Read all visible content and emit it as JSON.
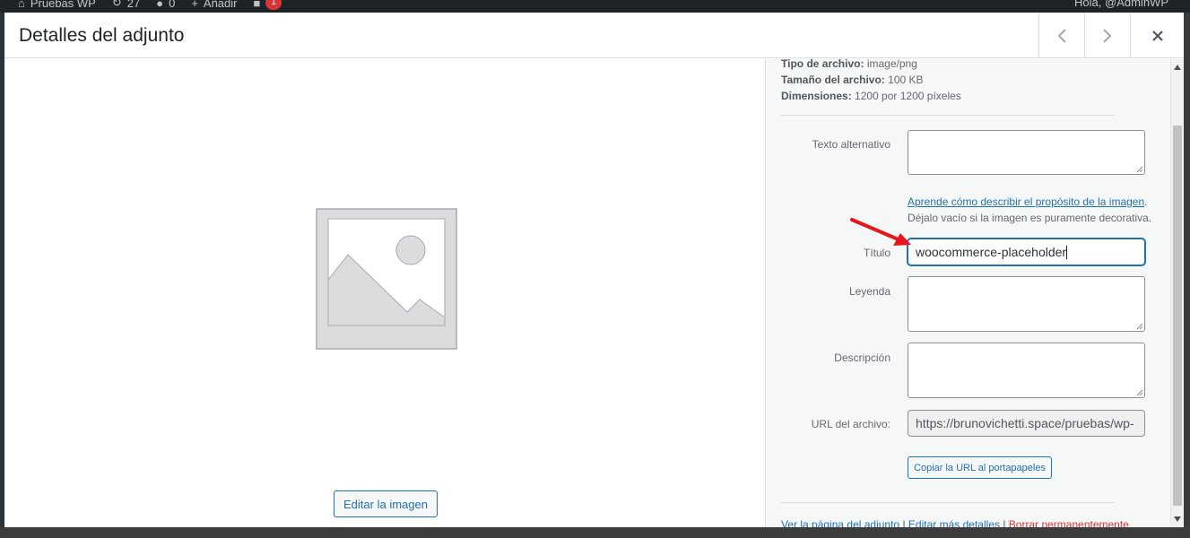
{
  "admin_bar": {
    "site_name": "Pruebas WP",
    "updates_count": "27",
    "comments_count": "0",
    "new_label": "Añadir",
    "badge_count": "1",
    "greeting": "Hola, @AdminWP"
  },
  "modal": {
    "title": "Detalles del adjunto",
    "prev_icon": "chevron-left-icon",
    "next_icon": "chevron-right-icon",
    "close_icon": "close-icon"
  },
  "image_pane": {
    "image_icon": "image-placeholder-icon",
    "edit_button": "Editar la imagen"
  },
  "details": {
    "file_type_label": "Tipo de archivo:",
    "file_type_value": "image/png",
    "file_size_label": "Tamaño del archivo:",
    "file_size_value": "100 KB",
    "dimensions_label": "Dimensiones:",
    "dimensions_value": "1200 por 1200 píxeles"
  },
  "form": {
    "alt_text_label": "Texto alternativo",
    "alt_text_value": "",
    "alt_help_link": "Aprende cómo describir el propósito de la imagen",
    "alt_help_rest": ". Déjalo vacío si la imagen es puramente decorativa.",
    "title_label": "Título",
    "title_value": "woocommerce-placeholder",
    "caption_label": "Leyenda",
    "caption_value": "",
    "description_label": "Descripción",
    "description_value": "",
    "file_url_label": "URL del archivo:",
    "file_url_value": "https://brunovichetti.space/pruebas/wp-",
    "copy_url_button": "Copiar la URL al portapapeles"
  },
  "actions": {
    "view_page": "Ver la página del adjunto",
    "separator": "|",
    "edit_more": "Editar más detalles",
    "delete": "Borrar permanentemente"
  },
  "colors": {
    "link": "#2271b1",
    "danger": "#d63638",
    "annotation_arrow": "#e8151b"
  }
}
